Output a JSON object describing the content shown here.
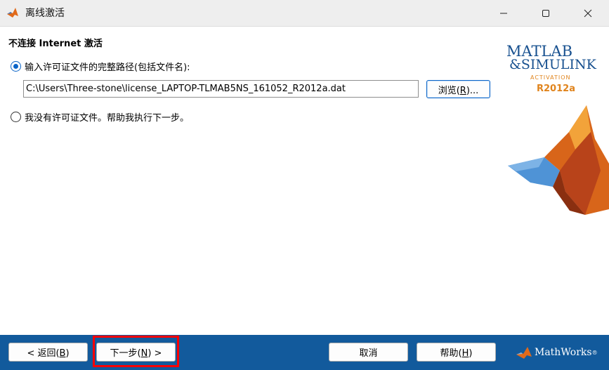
{
  "window": {
    "title": "离线激活",
    "icon": "matlab-membrane-icon"
  },
  "main": {
    "section_title": "不连接 Internet 激活",
    "option_path_label": "输入许可证文件的完整路径(包括文件名):",
    "option_path_selected": true,
    "path_value": "C:\\Users\\Three-stone\\license_LAPTOP-TLMAB5NS_161052_R2012a.dat",
    "browse_label_prefix": "浏览(",
    "browse_label_key": "R",
    "browse_label_suffix": ")...",
    "option_none_label": "我没有许可证文件。帮助我执行下一步。",
    "option_none_selected": false
  },
  "logo": {
    "line1": "MATLAB",
    "line2": "&SIMULINK",
    "activation": "ACTIVATION",
    "release": "R2012a"
  },
  "footer": {
    "back_prefix": "< 返回(",
    "back_key": "B",
    "back_suffix": ")",
    "next_prefix": "下一步(",
    "next_key": "N",
    "next_suffix": ") >",
    "cancel_label": "取消",
    "help_prefix": "帮助(",
    "help_key": "H",
    "help_suffix": ")",
    "brand": "MathWorks",
    "brand_reg": "®"
  },
  "colors": {
    "footer_bg": "#125a9c",
    "accent": "#0a64c8",
    "highlight": "#ff0000"
  }
}
